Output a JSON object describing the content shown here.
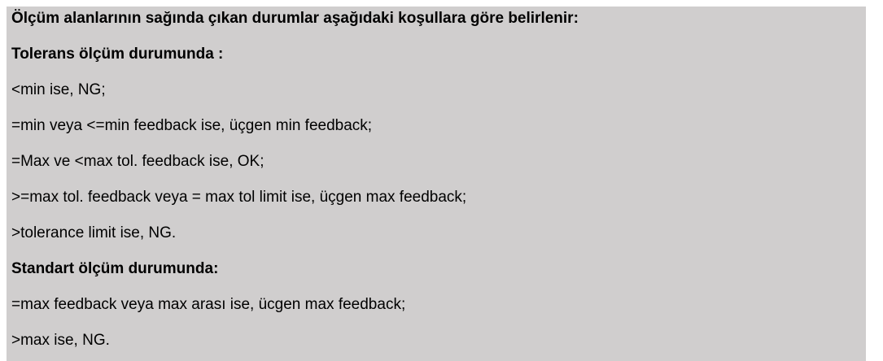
{
  "document": {
    "lines": [
      "Ölçüm alanlarının sağında çıkan durumlar aşağıdaki koşullara göre belirlenir:",
      "Tolerans ölçüm durumunda :",
      "<min ise, NG;",
      "=min veya <=min feedback ise, üçgen min feedback;",
      "=Max ve <max tol. feedback ise, OK;",
      ">=max tol. feedback veya = max tol limit ise, üçgen max feedback;",
      ">tolerance limit ise, NG.",
      "Standart ölçüm durumunda:",
      "=max feedback veya max arası ise, ücgen max feedback;",
      ">max ise, NG."
    ],
    "background_color": "#d0cece",
    "text_color": "#000000"
  }
}
